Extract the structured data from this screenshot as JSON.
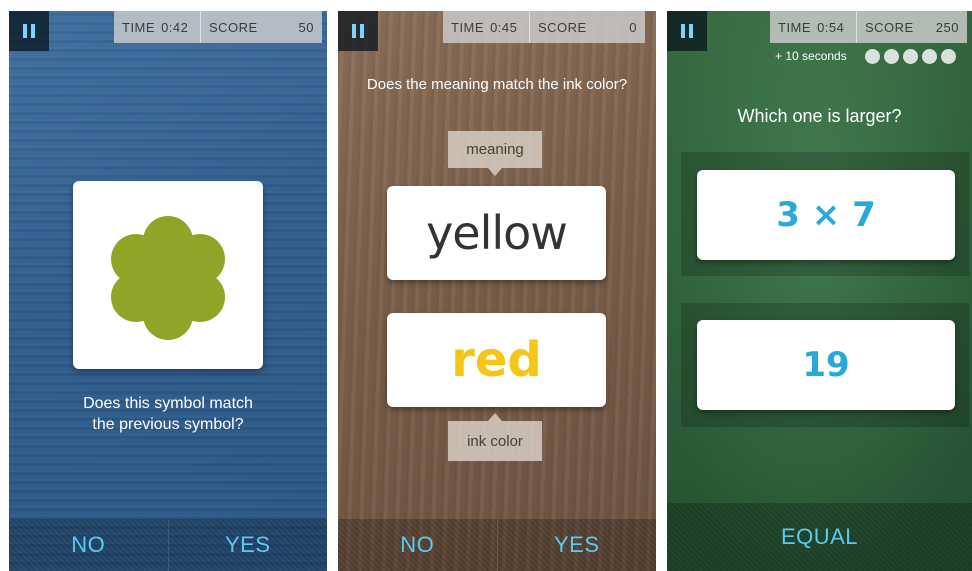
{
  "screens": [
    {
      "hud": {
        "time_label": "TIME",
        "time": "0:42",
        "score_label": "SCORE",
        "score": "50"
      },
      "question": [
        "Does this symbol match",
        "the previous symbol?"
      ],
      "symbol": {
        "shape": "flower-icon",
        "color": "#8fa528"
      },
      "buttons": {
        "no": "NO",
        "yes": "YES"
      }
    },
    {
      "hud": {
        "time_label": "TIME",
        "time": "0:45",
        "score_label": "SCORE",
        "score": "0"
      },
      "question": "Does the meaning match the ink color?",
      "meaning_tag": "meaning",
      "meaning_word": "yellow",
      "meaning_color": "#333333",
      "ink_word": "red",
      "ink_color": "#f5c518",
      "ink_tag": "ink color",
      "buttons": {
        "no": "NO",
        "yes": "YES"
      }
    },
    {
      "hud": {
        "time_label": "TIME",
        "time": "0:54",
        "score_label": "SCORE",
        "score": "250"
      },
      "bonus": "+ 10 seconds",
      "progress_dots": 5,
      "question": "Which one is larger?",
      "top_card": "3 × 7",
      "bottom_card": "19",
      "number_color": "#29a8dc",
      "buttons": {
        "equal": "EQUAL"
      }
    }
  ]
}
